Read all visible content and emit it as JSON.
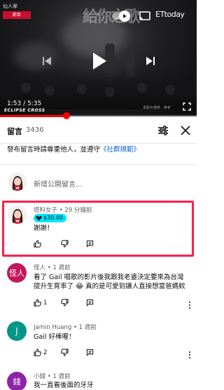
{
  "player": {
    "logo_top": "仙人掌",
    "logo_channel": "節目",
    "watermark": "給你之歌",
    "brand": "ETtoday",
    "time_current": "1:53",
    "time_total": "5:35",
    "time_display": "1:53 / 5:35",
    "sponsor": "ECLIPSE CROSS",
    "caption_small": "本影片僅供 · 參考",
    "progress_fraction": 0.337
  },
  "comments_panel": {
    "title": "留言",
    "count": "3436",
    "notice_prefix": "發布留言時請尊重他人，並遵守",
    "notice_link": "《社群規範》",
    "add_placeholder": "新增公開留言..."
  },
  "comments": [
    {
      "author": "塔科女子",
      "time": "29 分鐘前",
      "meta": "塔科女子 • 29 分鐘前",
      "super_thanks": "$30.00",
      "text": "謝謝！",
      "likes": ""
    },
    {
      "author": "怪人",
      "avatar_text": "怪人",
      "avatar_color": "#c2185b",
      "time": "1 週前",
      "meta": "怪人 • 1 週前",
      "text": "看了 Gail 唱歌的影片後我跟我老婆決定要來為台灣提升生育率了 😂 真的是可愛到讓人直接想當爸媽欸",
      "likes": "1"
    },
    {
      "author": "Jamin Huang",
      "avatar_text": "J",
      "avatar_color": "#009688",
      "time": "1 週前",
      "meta": "Jamin Huang • 1 週前",
      "text": "Gail 好棒喔！",
      "likes": "2"
    },
    {
      "author": "小錢",
      "avatar_text": "錢",
      "avatar_color": "#8e24aa",
      "time": "1 週前",
      "meta": "小錢 • 1 週前",
      "text": "我一直看後面的牙牙",
      "likes": ""
    }
  ],
  "colors": {
    "accent": "#ff0000",
    "highlight_border": "#ff1f4e",
    "super_thanks_bg": "#00e5ff",
    "link": "#065fd4"
  }
}
